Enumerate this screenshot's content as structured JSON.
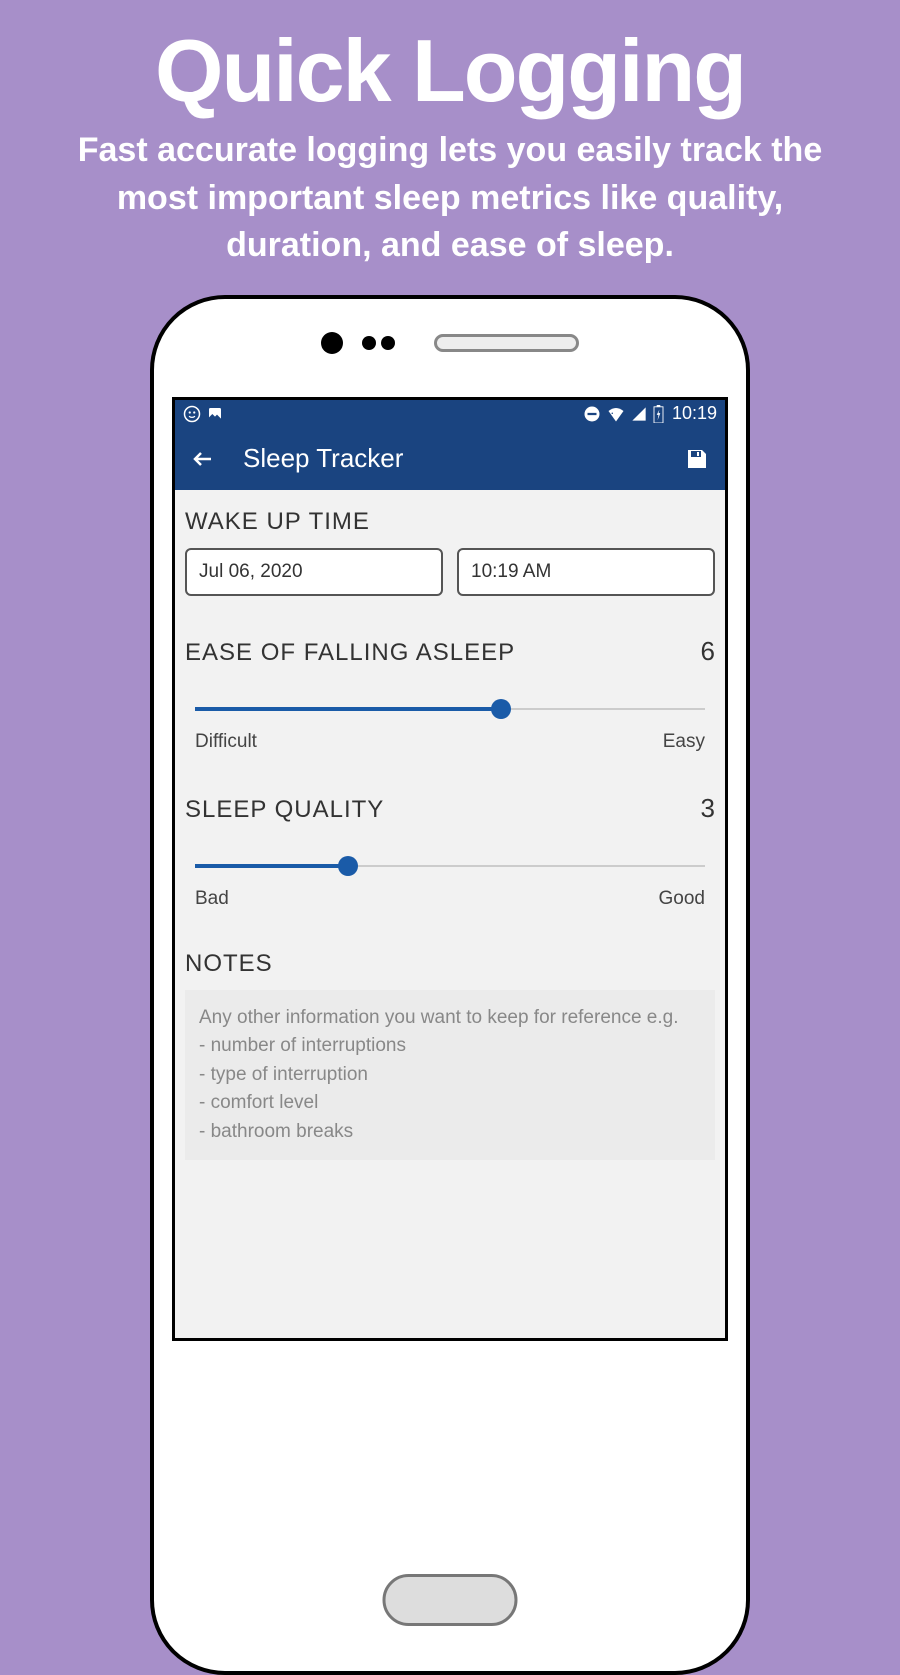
{
  "promo": {
    "title": "Quick Logging",
    "subtitle": "Fast accurate logging lets you easily track the most important sleep metrics like quality, duration, and ease of sleep."
  },
  "statusBar": {
    "time": "10:19"
  },
  "appBar": {
    "title": "Sleep Tracker"
  },
  "sections": {
    "wake": {
      "label": "WAKE UP TIME",
      "date": "Jul 06, 2020",
      "time": "10:19 AM"
    },
    "ease": {
      "label": "EASE OF FALLING ASLEEP",
      "value": "6",
      "percent": 60,
      "minLabel": "Difficult",
      "maxLabel": "Easy"
    },
    "quality": {
      "label": "SLEEP QUALITY",
      "value": "3",
      "percent": 30,
      "minLabel": "Bad",
      "maxLabel": "Good"
    },
    "notes": {
      "label": "NOTES",
      "placeholder": "Any other information you want to keep for reference e.g.\n- number of interruptions\n- type of interruption\n- comfort level\n- bathroom breaks"
    }
  }
}
